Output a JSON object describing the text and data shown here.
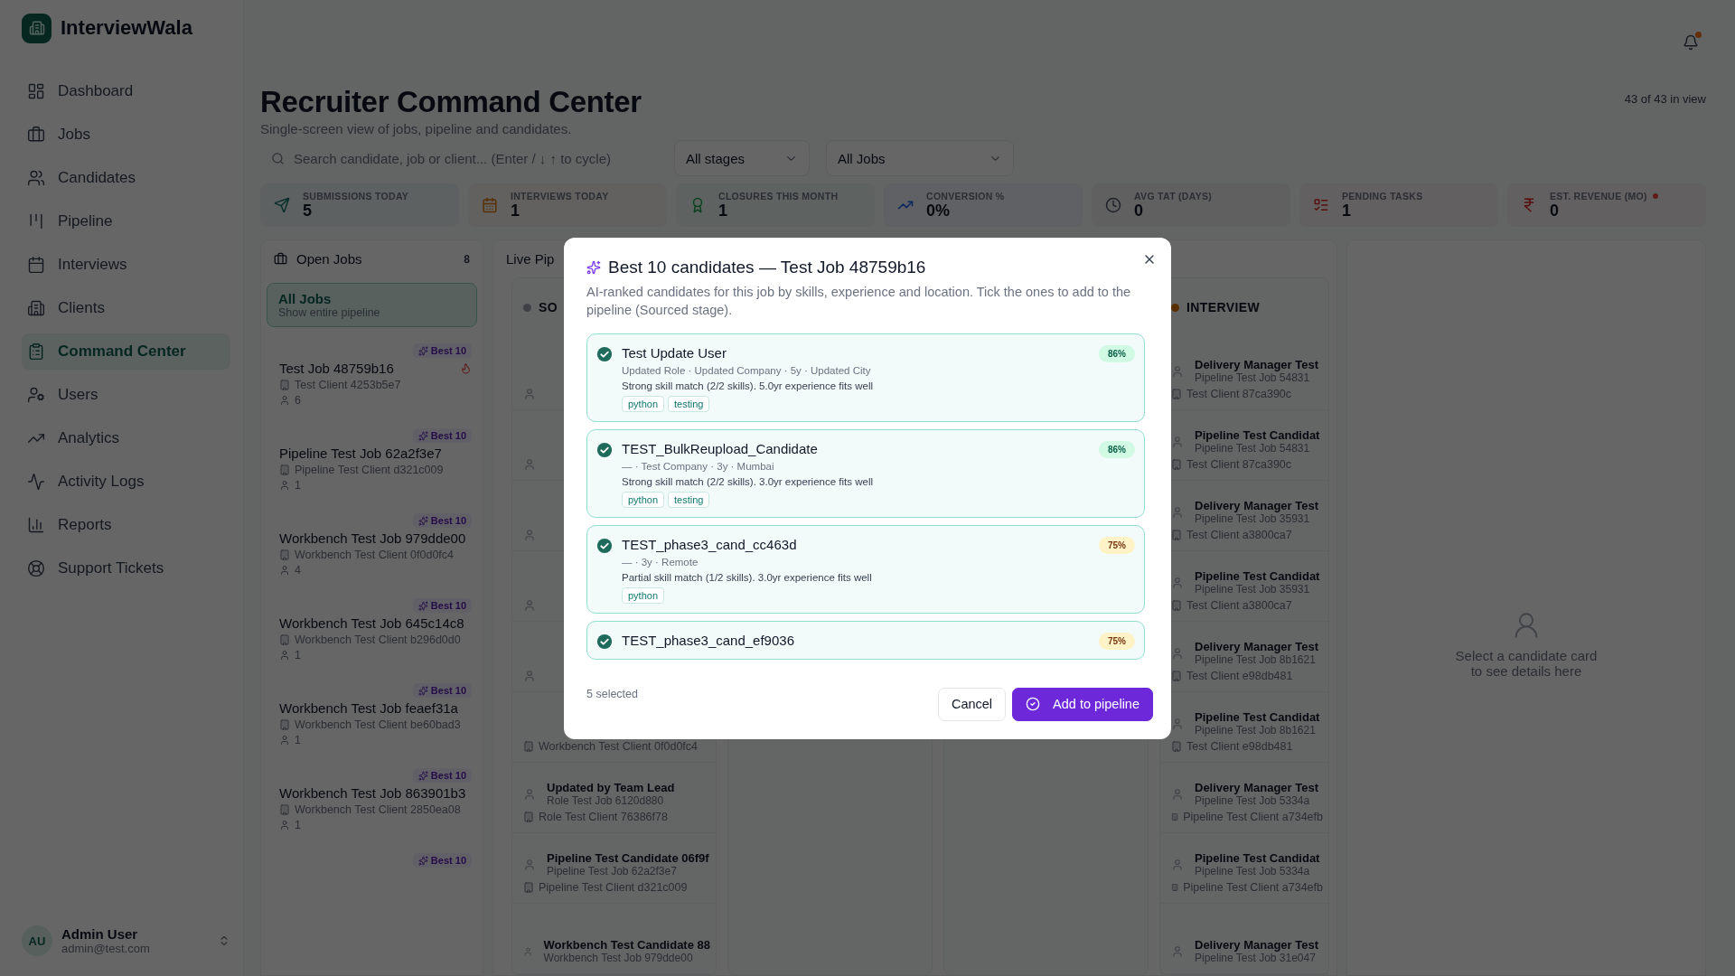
{
  "app": {
    "name": "InterviewWala"
  },
  "nav": [
    {
      "label": "Dashboard",
      "selected": false
    },
    {
      "label": "Jobs",
      "selected": false
    },
    {
      "label": "Candidates",
      "selected": false
    },
    {
      "label": "Pipeline",
      "selected": false
    },
    {
      "label": "Interviews",
      "selected": false
    },
    {
      "label": "Clients",
      "selected": false
    },
    {
      "label": "Command Center",
      "selected": true
    },
    {
      "label": "Users",
      "selected": false
    },
    {
      "label": "Analytics",
      "selected": false
    },
    {
      "label": "Activity Logs",
      "selected": false
    },
    {
      "label": "Reports",
      "selected": false
    },
    {
      "label": "Support Tickets",
      "selected": false
    }
  ],
  "user": {
    "initials": "AU",
    "name": "Admin User",
    "email": "admin@test.com"
  },
  "notifications": {
    "unread": true
  },
  "page": {
    "title": "Recruiter Command Center",
    "subtitle": "Single-screen view of jobs, pipeline and candidates.",
    "count": "43 of 43 in view"
  },
  "search": {
    "placeholder": "Search candidate, job or client... (Enter / ↓ ↑ to cycle)"
  },
  "filters": [
    {
      "value": "All stages"
    },
    {
      "value": "All Jobs"
    }
  ],
  "stats": [
    {
      "label": "SUBMISSIONS TODAY",
      "value": "5",
      "kind": "submissions",
      "alert": false
    },
    {
      "label": "INTERVIEWS TODAY",
      "value": "1",
      "kind": "interviews",
      "alert": false
    },
    {
      "label": "CLOSURES THIS MONTH",
      "value": "1",
      "kind": "closures",
      "alert": false
    },
    {
      "label": "CONVERSION %",
      "value": "0%",
      "kind": "conversion",
      "alert": false
    },
    {
      "label": "AVG TAT (DAYS)",
      "value": "0",
      "kind": "tat",
      "alert": false
    },
    {
      "label": "PENDING TASKS",
      "value": "1",
      "kind": "tasks",
      "alert": false
    },
    {
      "label": "EST. REVENUE (MO)",
      "value": "0",
      "kind": "revenue",
      "alert": true
    }
  ],
  "open_jobs": {
    "title": "Open Jobs",
    "count": "8",
    "all": {
      "title": "All Jobs",
      "subtitle": "Show entire pipeline",
      "selected": true
    },
    "items": [
      {
        "badge": "Best 10",
        "title": "Test Job 48759b16",
        "client": "Test Client 4253b5e7",
        "candidates": "6",
        "hot": true
      },
      {
        "badge": "Best 10",
        "title": "Pipeline Test Job 62a2f3e7",
        "client": "Pipeline Test Client d321c009",
        "candidates": "1",
        "hot": false
      },
      {
        "badge": "Best 10",
        "title": "Workbench Test Job 979dde00",
        "client": "Workbench Test Client 0f0d0fc4",
        "candidates": "4",
        "hot": false
      },
      {
        "badge": "Best 10",
        "title": "Workbench Test Job 645c14c8",
        "client": "Workbench Test Client b296d0d0",
        "candidates": "1",
        "hot": false
      },
      {
        "badge": "Best 10",
        "title": "Workbench Test Job feaef31a",
        "client": "Workbench Test Client be60bad3",
        "candidates": "1",
        "hot": false
      },
      {
        "badge": "Best 10",
        "title": "Workbench Test Job 863901b3",
        "client": "Workbench Test Client 2850ea08",
        "candidates": "1",
        "hot": false
      },
      {
        "badge": "Best 10"
      }
    ]
  },
  "pipeline": {
    "title": "Live Pip",
    "columns": [
      {
        "title": "SO",
        "kind": "sourced",
        "cards": [
          {
            "kind": "covered"
          },
          {
            "kind": "covered"
          },
          {
            "kind": "covered"
          },
          {
            "kind": "covered"
          },
          {
            "kind": "covered"
          },
          {
            "kind": "card",
            "client": "Workbench Test Client 0f0d0fc4"
          },
          {
            "kind": "card",
            "name": "Updated by Team Lead",
            "job": "Role Test Job 6120d880",
            "client": "Role Test Client 76386f78"
          },
          {
            "kind": "card",
            "name": "Pipeline Test Candidate 06f9f",
            "job": "Pipeline Test Job 62a2f3e7",
            "client": "Pipeline Test Client d321c009"
          },
          {
            "kind": "card",
            "name": "Workbench Test Candidate 88",
            "job": "Workbench Test Job 979dde00"
          }
        ]
      },
      {},
      {},
      {
        "title": "INTERVIEW",
        "kind": "interview",
        "cards": [
          {
            "kind": "card",
            "name": "Delivery Manager Test",
            "job": "Pipeline Test Job 54831",
            "client": "Test Client 87ca390c"
          },
          {
            "kind": "card",
            "name": "Pipeline Test Candidat",
            "job": "Pipeline Test Job 54831",
            "client": "Test Client 87ca390c"
          },
          {
            "kind": "card",
            "name": "Delivery Manager Test",
            "job": "Pipeline Test Job 35931",
            "client": "Test Client a3800ca7"
          },
          {
            "kind": "card",
            "name": "Pipeline Test Candidat",
            "job": "Pipeline Test Job 35931",
            "client": "Test Client a3800ca7"
          },
          {
            "kind": "card",
            "name": "Delivery Manager Test",
            "job": "Pipeline Test Job 8b1621",
            "client": "Test Client e98db481"
          },
          {
            "kind": "card",
            "name": "Pipeline Test Candidat",
            "job": "Pipeline Test Job 8b1621",
            "client": "Test Client e98db481"
          },
          {
            "kind": "card",
            "name": "Delivery Manager Test",
            "job": "Pipeline Test Job 5334a",
            "client": "Pipeline Test Client a734efb"
          },
          {
            "kind": "card",
            "name": "Pipeline Test Candidat",
            "job": "Pipeline Test Job 5334a",
            "client": "Pipeline Test Client a734efb"
          },
          {
            "kind": "card",
            "name": "Delivery Manager Test",
            "job": "Pipeline Test Job 31e047"
          }
        ]
      }
    ]
  },
  "details": {
    "empty": "Select a candidate card to see details here"
  },
  "modal": {
    "title": "Best 10 candidates — Test Job 48759b16",
    "description": "AI-ranked candidates for this job by skills, experience and location. Tick the ones to add to the pipeline (Sourced stage).",
    "candidates": [
      {
        "name": "Test Update User",
        "meta": "Updated Role · Updated Company · 5y · Updated City",
        "reason": "Strong skill match (2/2 skills). 5.0yr experience fits well",
        "skills": [
          "python",
          "testing"
        ],
        "score": "86%",
        "kind": "strong",
        "selected": true
      },
      {
        "name": "TEST_BulkReupload_Candidate",
        "meta": "— · Test Company · 3y · Mumbai",
        "reason": "Strong skill match (2/2 skills). 3.0yr experience fits well",
        "skills": [
          "python",
          "testing"
        ],
        "score": "86%",
        "kind": "strong",
        "selected": true
      },
      {
        "name": "TEST_phase3_cand_cc463d",
        "meta": "— · 3y · Remote",
        "reason": "Partial skill match (1/2 skills). 3.0yr experience fits well",
        "skills": [
          "python"
        ],
        "score": "75%",
        "kind": "partial",
        "selected": true
      },
      {
        "name": "TEST_phase3_cand_ef9036",
        "score": "75%",
        "kind": "partial",
        "selected": true
      }
    ],
    "selection": "5 selected",
    "buttons": [
      {
        "label": "Cancel",
        "kind": "secondary"
      },
      {
        "label": "Add to pipeline",
        "kind": "primary"
      }
    ]
  }
}
